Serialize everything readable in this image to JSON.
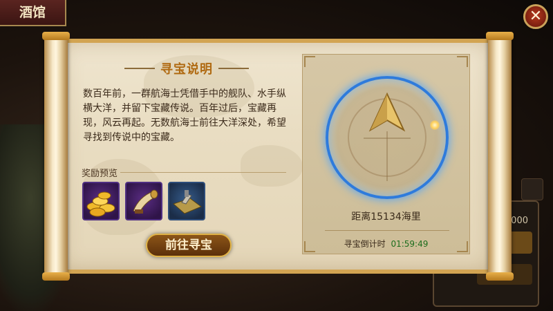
{
  "header": {
    "title": "酒馆"
  },
  "close_button": {
    "label": "✕"
  },
  "panel": {
    "section_title": "寻宝说明",
    "description": "数百年前，一群航海士凭借手中的舰队、水手纵横大洋，并留下宝藏传说。百年过后，宝藏再现，风云再起。无数航海士前往大洋深处，希望寻找到传说中的宝藏。",
    "reward_label": "奖励预览",
    "rewards": [
      {
        "icon": "gold-coins-icon"
      },
      {
        "icon": "war-horn-icon"
      },
      {
        "icon": "treasure-map-icon"
      }
    ],
    "go_button": "前往寻宝"
  },
  "compass": {
    "distance": "距离15134海里",
    "countdown_label": "寻宝倒计时",
    "countdown_time": "01:59:49"
  },
  "background": {
    "partial_text": "0000"
  },
  "colors": {
    "accent_gold": "#e0b347",
    "compass_blue": "#2e7bdc",
    "timer_green": "#1c6d1c"
  }
}
